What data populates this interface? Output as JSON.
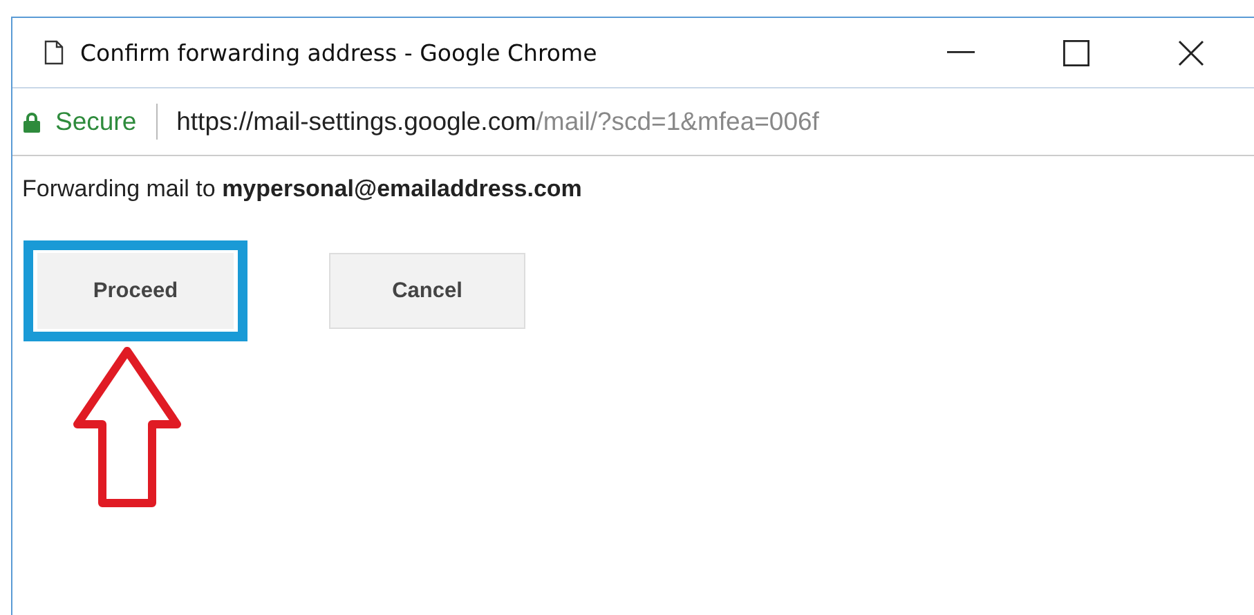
{
  "window": {
    "title": "Confirm forwarding address - Google Chrome"
  },
  "address_bar": {
    "secure_label": "Secure",
    "url_host": "https://mail-settings.google.com",
    "url_path": "/mail/?scd=1&mfea=006f"
  },
  "message": "Forwarding mail to **mypersonal@emailaddress.com**",
  "buttons": [
    {
      "label": "Proceed",
      "highlighted": true
    },
    {
      "label": "Cancel",
      "highlighted": false
    }
  ]
}
